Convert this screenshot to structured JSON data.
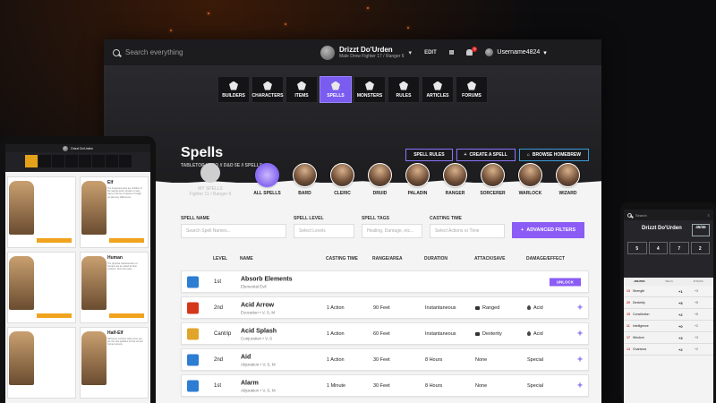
{
  "topbar": {
    "search_placeholder": "Search everything",
    "user_name": "Drizzt Do'Urden",
    "user_sub": "Male Drow Fighter 17 / Ranger 6",
    "edit_label": "EDIT",
    "notification_count": "9",
    "username": "Username4824"
  },
  "nav": [
    {
      "label": "BUILDERS"
    },
    {
      "label": "CHARACTERS"
    },
    {
      "label": "ITEMS"
    },
    {
      "label": "SPELLS"
    },
    {
      "label": "MONSTERS"
    },
    {
      "label": "RULES"
    },
    {
      "label": "ARTICLES"
    },
    {
      "label": "FORUMS"
    }
  ],
  "page": {
    "title": "Spells",
    "breadcrumb": "TABLETOP HERO  //  D&D 5E  //  SPELLS",
    "actions": {
      "rules": "SPELL RULES",
      "create": "CREATE A SPELL",
      "homebrew": "BROWSE HOMEBREW"
    }
  },
  "myspells": {
    "label": "MY SPELLS",
    "sub": "Fighter 11 / Ranger 6"
  },
  "classes": [
    {
      "label": "ALL SPELLS"
    },
    {
      "label": "BARD"
    },
    {
      "label": "CLERIC"
    },
    {
      "label": "DRUID"
    },
    {
      "label": "PALADIN"
    },
    {
      "label": "RANGER"
    },
    {
      "label": "SORCERER"
    },
    {
      "label": "WARLOCK"
    },
    {
      "label": "WIZARD"
    }
  ],
  "filters": {
    "name_label": "SPELL NAME",
    "name_placeholder": "Search Spell Names...",
    "level_label": "SPELL LEVEL",
    "level_placeholder": "Select Levels",
    "tags_label": "SPELL TAGS",
    "tags_placeholder": "Healing, Damage, etc...",
    "time_label": "CASTING TIME",
    "time_placeholder": "Select Actions or Time",
    "advanced": "ADVANCED FILTERS"
  },
  "columns": {
    "level": "LEVEL",
    "name": "NAME",
    "time": "CASTING TIME",
    "range": "RANGE/AREA",
    "duration": "DURATION",
    "attack": "ATTACK/SAVE",
    "effect": "DAMAGE/EFFECT"
  },
  "spells": [
    {
      "level": "1st",
      "name": "Absorb Elements",
      "sub": "Elemental Evil",
      "time": "",
      "range": "",
      "duration": "",
      "attack": "",
      "effect": "",
      "action": "UNLOCK"
    },
    {
      "level": "2nd",
      "name": "Acid Arrow",
      "sub": "Evocation • V, S, M",
      "time": "1 Action",
      "range": "90 Feet",
      "duration": "Instantaneous",
      "attack": "Ranged",
      "effect": "Acid"
    },
    {
      "level": "Cantrip",
      "name": "Acid Splash",
      "sub": "Conjuration • V, S",
      "time": "1 Action",
      "range": "60 Feet",
      "duration": "Instantaneous",
      "attack": "Dexterity",
      "effect": "Acid"
    },
    {
      "level": "2nd",
      "name": "Aid",
      "sub": "Abjuration • V, S, M",
      "time": "1 Action",
      "range": "30 Feet",
      "duration": "8 Hours",
      "attack": "None",
      "effect": "Special"
    },
    {
      "level": "1st",
      "name": "Alarm",
      "sub": "Abjuration • V, S, M",
      "time": "1 Minute",
      "range": "30 Feet",
      "duration": "8 Hours",
      "attack": "None",
      "effect": "Special"
    }
  ],
  "tablet": {
    "user": "Drizzt Do'Urden",
    "cards": [
      {
        "name": "Elf",
        "desc": "The long-lived elves are children of the natural world, similar in many ways to the fey creatures of magic, yet also key differences."
      },
      {
        "name": "Human",
        "desc": "The physical characteristics of humans are as varied as their customs. Given the past..."
      },
      {
        "name": "Half-Elf",
        "desc": "Half-elves combine what some say are the best qualities of their elf and human parents."
      }
    ]
  },
  "phone": {
    "search": "Search",
    "name": "Drizzt Do'Urden",
    "hp": "45/45",
    "tabs": [
      "ABILITIES",
      "SKILLS",
      "ATTACKS"
    ],
    "abilities": [
      {
        "score": "13",
        "name": "Strength",
        "mod": "+1",
        "save": "+3"
      },
      {
        "score": "20",
        "name": "Dexterity",
        "mod": "+5",
        "save": "+5"
      },
      {
        "score": "15",
        "name": "Constitution",
        "mod": "+2",
        "save": "+5"
      },
      {
        "score": "11",
        "name": "Intelligence",
        "mod": "+0",
        "save": "+2"
      },
      {
        "score": "17",
        "name": "Wisdom",
        "mod": "+3",
        "save": "+3"
      },
      {
        "score": "14",
        "name": "Charisma",
        "mod": "+2",
        "save": "+2"
      }
    ]
  }
}
